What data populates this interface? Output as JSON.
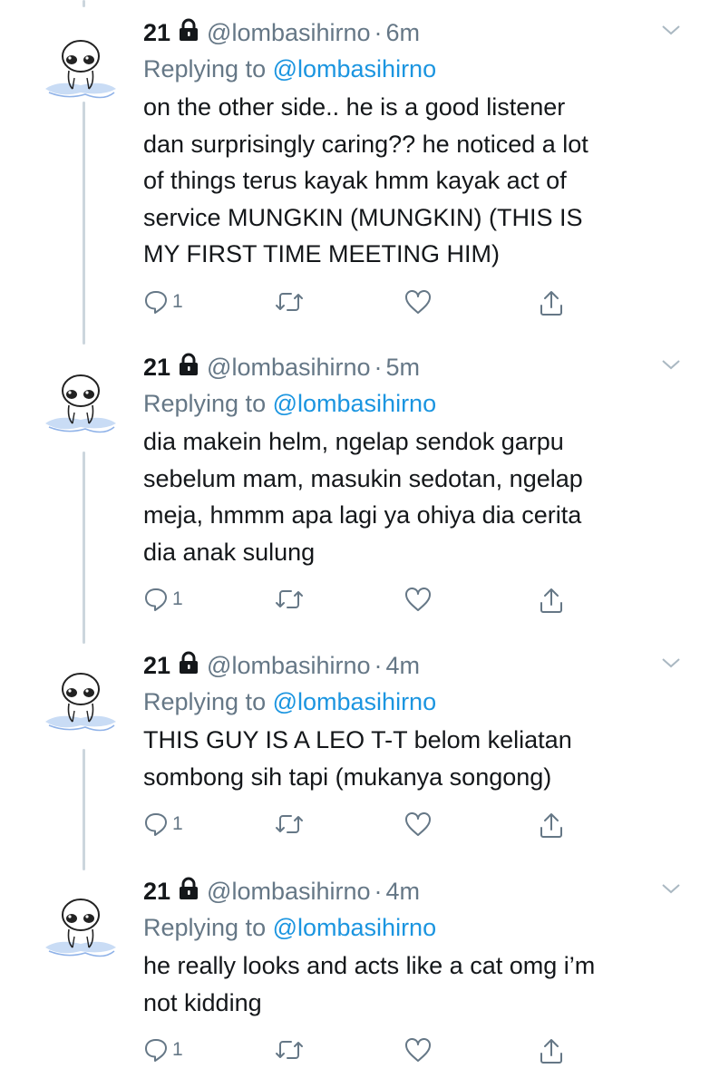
{
  "tweets": [
    {
      "name": "21",
      "handle": "@lombasihirno",
      "separator": "·",
      "time": "6m",
      "replying_prefix": "Replying to",
      "replying_handle": "@lombasihirno",
      "lines": [
        "on the other side.. he is a good listener",
        "dan surprisingly caring?? he noticed a lot",
        "of things terus kayak hmm kayak act of",
        "service MUNGKIN (MUNGKIN) (THIS IS",
        "MY FIRST TIME MEETING HIM)"
      ],
      "reply_count": "1"
    },
    {
      "name": "21",
      "handle": "@lombasihirno",
      "separator": "·",
      "time": "5m",
      "replying_prefix": "Replying to",
      "replying_handle": "@lombasihirno",
      "lines": [
        "dia makein helm, ngelap sendok garpu",
        "sebelum mam, masukin sedotan, ngelap",
        "meja, hmmm apa lagi ya ohiya dia cerita",
        "dia anak sulung"
      ],
      "reply_count": "1"
    },
    {
      "name": "21",
      "handle": "@lombasihirno",
      "separator": "·",
      "time": "4m",
      "replying_prefix": "Replying to",
      "replying_handle": "@lombasihirno",
      "lines": [
        "THIS GUY IS A LEO T-T belom keliatan",
        "sombong sih tapi (mukanya songong)"
      ],
      "reply_count": "1"
    },
    {
      "name": "21",
      "handle": "@lombasihirno",
      "separator": "·",
      "time": "4m",
      "replying_prefix": "Replying to",
      "replying_handle": "@lombasihirno",
      "lines": [
        "he really looks and acts like a cat omg i’m",
        "not kidding"
      ],
      "reply_count": "1"
    }
  ],
  "icons": {
    "lock": "lock-icon",
    "chevron": "chevron-down-icon",
    "reply": "reply-icon",
    "retweet": "retweet-icon",
    "like": "heart-icon",
    "share": "share-icon"
  },
  "colors": {
    "text": "#14171a",
    "secondary": "#657786",
    "link": "#1b95e0",
    "thread_line": "#ccd6dd"
  }
}
